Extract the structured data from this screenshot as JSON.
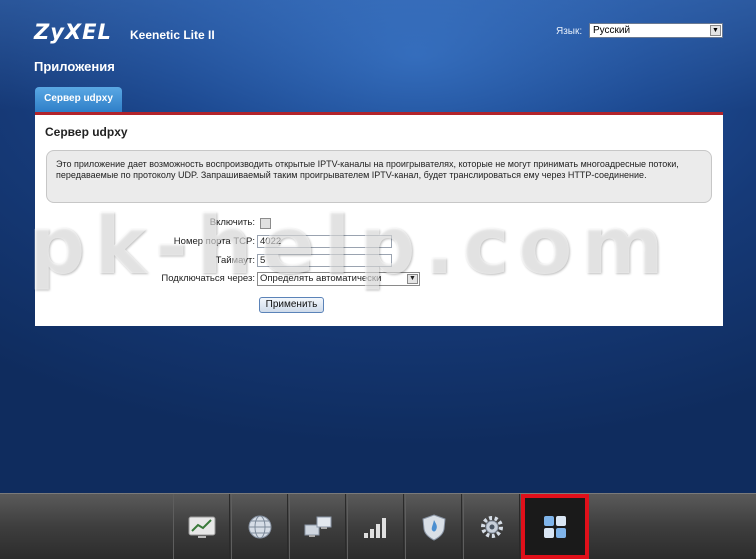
{
  "header": {
    "logo": "ZyXEL",
    "model": "Keenetic Lite II",
    "language_label": "Язык:",
    "language_value": "Русский"
  },
  "page": {
    "title": "Приложения",
    "tab_label": "Сервер udpxy"
  },
  "panel": {
    "title": "Сервер udpxy",
    "info_text": "Это приложение дает возможность воспроизводить открытые IPTV-каналы на проигрывателях, которые не могут принимать многоадресные потоки, передаваемые по протоколу UDP. Запрашиваемый таким проигрывателем IPTV-канал, будет транслироваться ему через HTTP-соединение."
  },
  "form": {
    "enable_label": "Включить:",
    "enable_checked": false,
    "tcp_port_label": "Номер порта TCP:",
    "tcp_port_value": "4022",
    "timeout_label": "Таймаут:",
    "timeout_value": "5",
    "connect_via_label": "Подключаться через:",
    "connect_via_value": "Определять автоматически",
    "apply_button": "Применить"
  },
  "watermark": "pk-help.com",
  "bottom_nav": [
    {
      "icon": "monitor-chart-icon"
    },
    {
      "icon": "globe-icon"
    },
    {
      "icon": "network-computers-icon"
    },
    {
      "icon": "signal-bars-icon"
    },
    {
      "icon": "shield-icon"
    },
    {
      "icon": "gear-icon"
    },
    {
      "icon": "apps-grid-icon",
      "active": true
    }
  ],
  "colors": {
    "accent_red": "#e0101a",
    "tab_blue": "#2f7fc8",
    "tab_underline": "#b2242b"
  }
}
